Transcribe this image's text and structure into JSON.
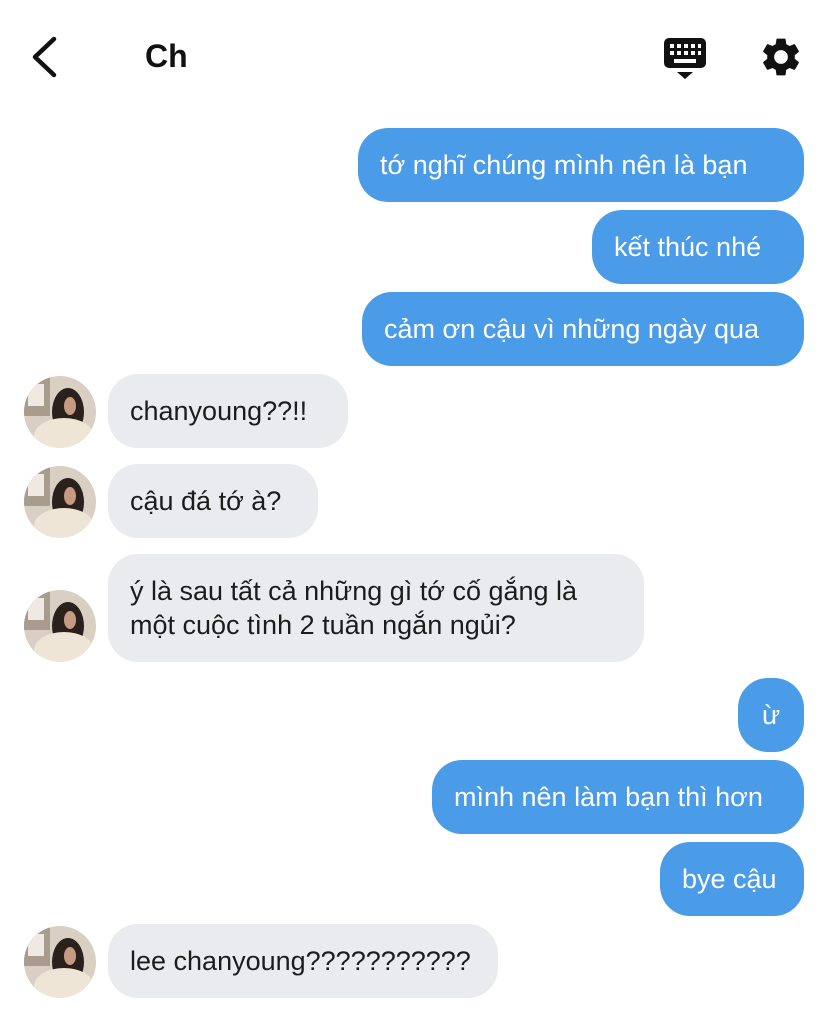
{
  "header": {
    "title": "Ch",
    "back_icon": "chevron-left-icon",
    "keyboard_icon": "keyboard-icon",
    "settings_icon": "gear-icon"
  },
  "colors": {
    "outgoing_bubble": "#4A9BE8",
    "incoming_bubble": "#E9EBEE",
    "outgoing_text": "#FFFFFF",
    "incoming_text": "#1C1C1C"
  },
  "messages": [
    {
      "from": "me",
      "text": "tớ nghĩ chúng mình nên là bạn"
    },
    {
      "from": "me",
      "text": "kết thúc nhé"
    },
    {
      "from": "me",
      "text": "cảm ơn cậu vì những ngày qua"
    },
    {
      "from": "them",
      "text": "chanyoung??!!"
    },
    {
      "from": "them",
      "text": "cậu đá tớ à?"
    },
    {
      "from": "them",
      "text": "ý là sau tất cả những gì tớ cố gắng là một cuộc tình 2 tuần ngắn ngủi?"
    },
    {
      "from": "me",
      "text": "ừ"
    },
    {
      "from": "me",
      "text": "mình nên làm bạn thì hơn"
    },
    {
      "from": "me",
      "text": "bye cậu"
    },
    {
      "from": "them",
      "text": "lee chanyoung???????????"
    }
  ]
}
